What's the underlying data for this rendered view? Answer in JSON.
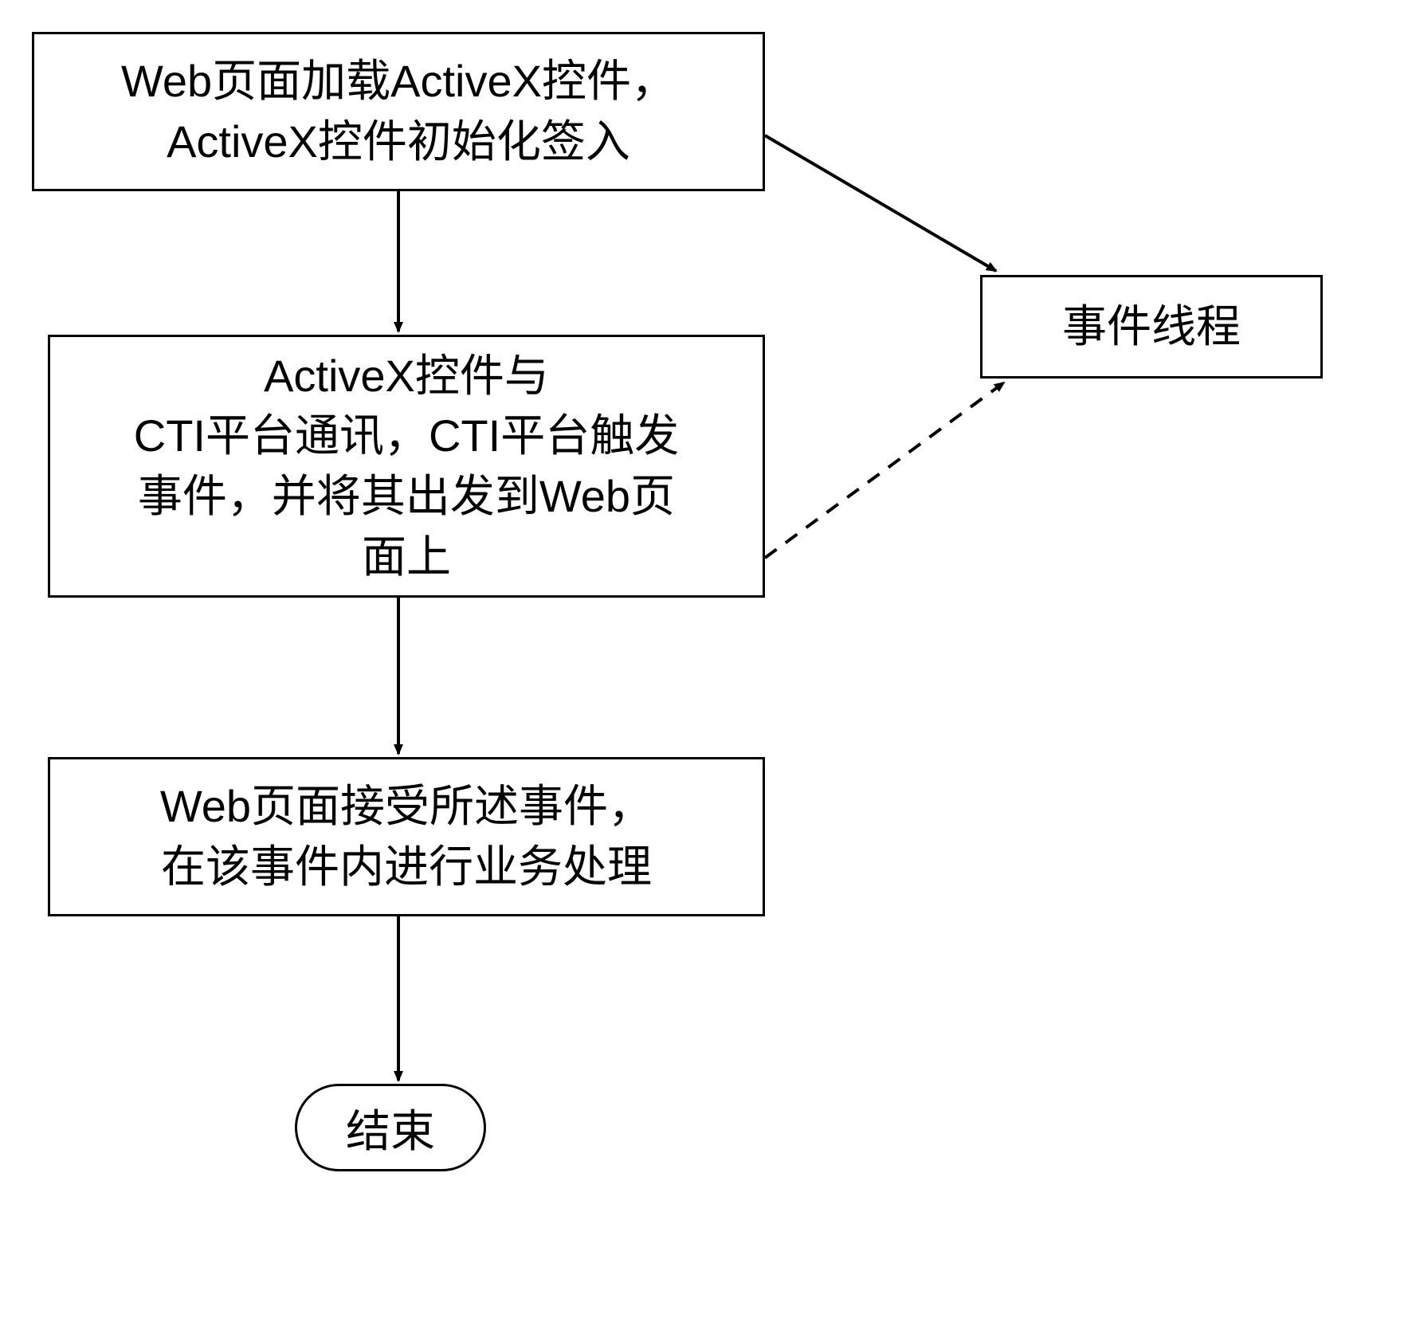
{
  "flowchart": {
    "box1": "Web页面加载ActiveX控件，\nActiveX控件初始化签入",
    "box2": "ActiveX控件与\nCTI平台通讯，CTI平台触发\n事件，并将其出发到Web页\n面上",
    "box3": "Web页面接受所述事件，\n在该事件内进行业务处理",
    "sidebox": "事件线程",
    "end": "结束"
  }
}
